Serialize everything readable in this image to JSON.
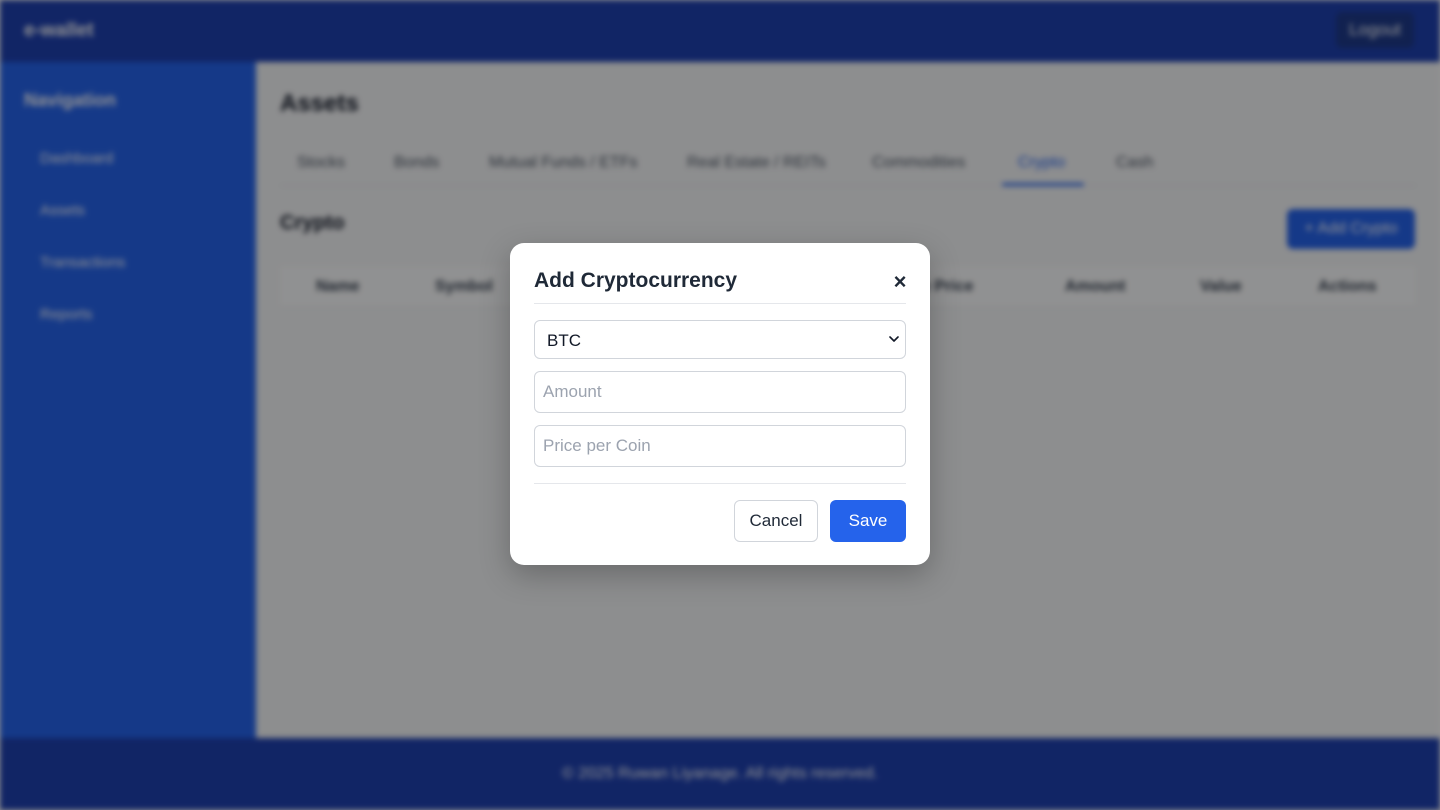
{
  "header": {
    "brand": "e-wallet",
    "logout_label": "Logout"
  },
  "sidebar": {
    "title": "Navigation",
    "items": [
      {
        "label": "Dashboard"
      },
      {
        "label": "Assets"
      },
      {
        "label": "Transactions"
      },
      {
        "label": "Reports"
      }
    ]
  },
  "main": {
    "title": "Assets",
    "tabs": [
      {
        "label": "Stocks",
        "active": false
      },
      {
        "label": "Bonds",
        "active": false
      },
      {
        "label": "Mutual Funds / ETFs",
        "active": false
      },
      {
        "label": "Real Estate / REITs",
        "active": false
      },
      {
        "label": "Commodities",
        "active": false
      },
      {
        "label": "Crypto",
        "active": true
      },
      {
        "label": "Cash",
        "active": false
      }
    ],
    "section_title": "Crypto",
    "add_button_label": "+ Add Crypto",
    "table_headers": [
      "Name",
      "Symbol",
      "",
      "e Price",
      "Amount",
      "Value",
      "Actions"
    ]
  },
  "footer": {
    "text": "© 2025 Ruwan Liyanage. All rights reserved."
  },
  "modal": {
    "title": "Add Cryptocurrency",
    "close_icon": "×",
    "coin_select_value": "BTC",
    "amount_placeholder": "Amount",
    "price_placeholder": "Price per Coin",
    "cancel_label": "Cancel",
    "save_label": "Save"
  },
  "colors": {
    "primary": "#2563eb",
    "header_bg": "#1e40af",
    "sidebar_bg": "#2563eb",
    "overlay": "rgba(0,0,0,0.42)"
  }
}
